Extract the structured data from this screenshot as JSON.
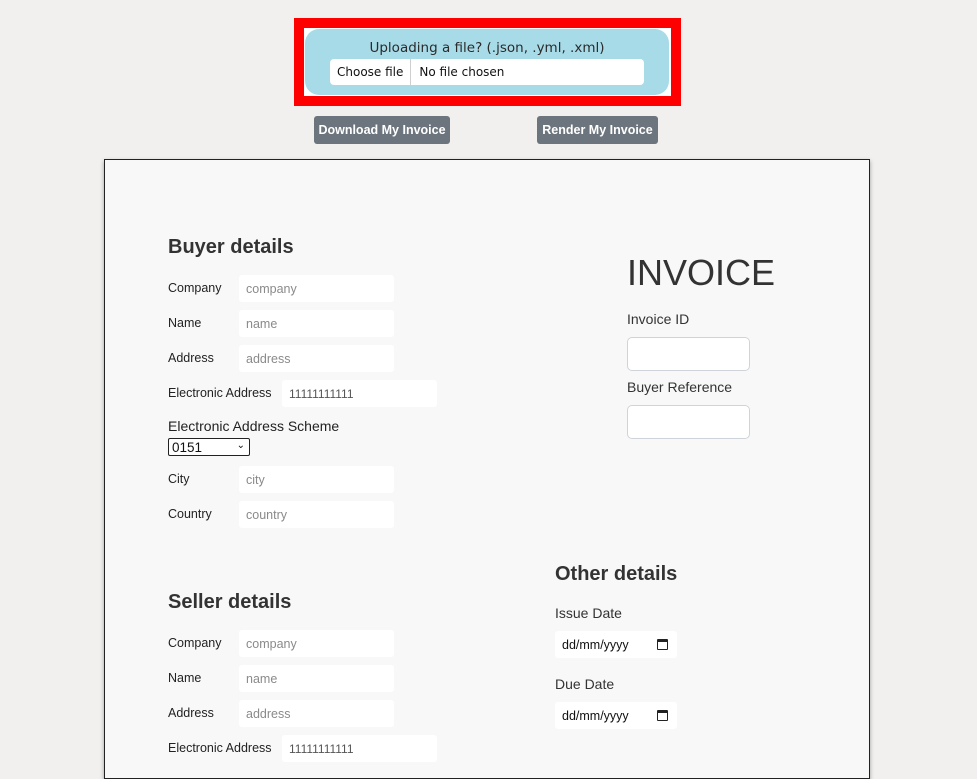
{
  "upload": {
    "title": "Uploading a file? (.json, .yml, .xml)",
    "choose_label": "Choose file",
    "status": "No file chosen"
  },
  "actions": {
    "download": "Download My Invoice",
    "render": "Render My Invoice"
  },
  "buyer": {
    "title": "Buyer details",
    "company_label": "Company",
    "company_placeholder": "company",
    "name_label": "Name",
    "name_placeholder": "name",
    "address_label": "Address",
    "address_placeholder": "address",
    "eaddress_label": "Electronic Address",
    "eaddress_value": "11111111111",
    "scheme_label": "Electronic Address Scheme",
    "scheme_value": "0151",
    "city_label": "City",
    "city_placeholder": "city",
    "country_label": "Country",
    "country_placeholder": "country"
  },
  "invoice": {
    "title": "INVOICE",
    "id_label": "Invoice ID",
    "id_value": "",
    "buyer_ref_label": "Buyer Reference",
    "buyer_ref_value": ""
  },
  "seller": {
    "title": "Seller details",
    "company_label": "Company",
    "company_placeholder": "company",
    "name_label": "Name",
    "name_placeholder": "name",
    "address_label": "Address",
    "address_placeholder": "address",
    "eaddress_label": "Electronic Address",
    "eaddress_value": "11111111111"
  },
  "other": {
    "title": "Other details",
    "issue_label": "Issue Date",
    "issue_value": "dd/mm/yyyy",
    "due_label": "Due Date",
    "due_value": "dd/mm/yyyy"
  }
}
